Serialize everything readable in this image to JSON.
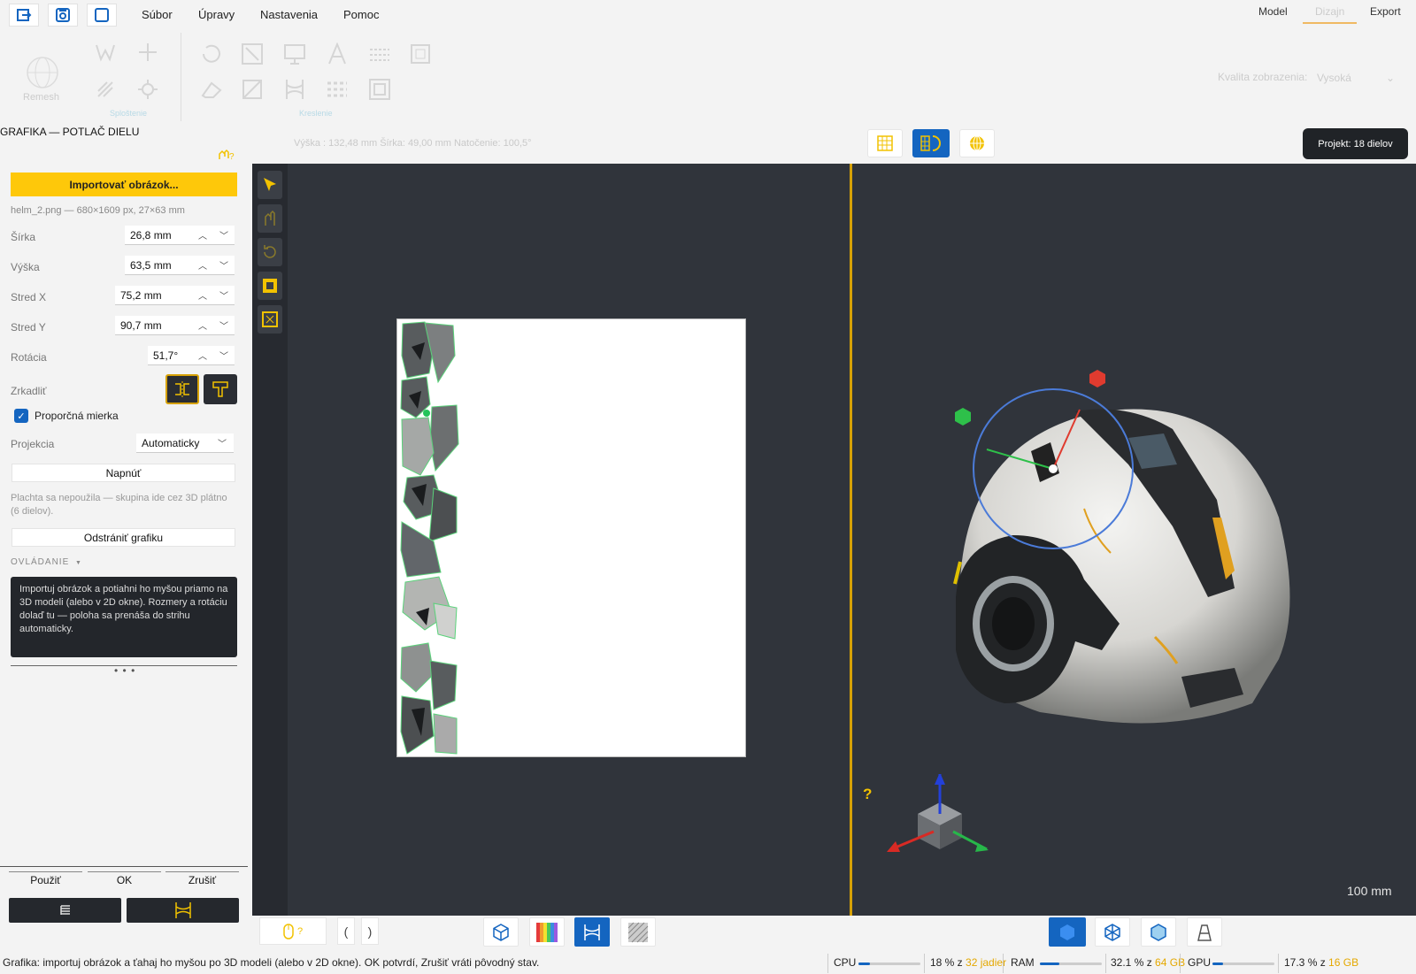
{
  "menubar": {
    "items": [
      "Súbor",
      "Úpravy",
      "Nastavenia",
      "Pomoc"
    ],
    "modes": [
      "Model",
      "Dizajn",
      "Export"
    ],
    "active_mode": "Dizajn"
  },
  "ribbon": {
    "remesh_label": "Remesh",
    "group1_label": "Sploštenie",
    "group2_label": "Kreslenie",
    "quality_label": "Kvalita zobrazenia:",
    "quality_value": "Vysoká"
  },
  "panel": {
    "title": "GRAFIKA — POTLAČ DIELU",
    "import_label": "Importovať obrázok...",
    "file_info": "helm_2.png — 680×1609 px, 27×63 mm",
    "fields": [
      {
        "label": "Šírka",
        "value": "26,8 mm"
      },
      {
        "label": "Výška",
        "value": "63,5 mm"
      },
      {
        "label": "Stred X",
        "value": "75,2 mm"
      },
      {
        "label": "Stred Y",
        "value": "90,7 mm"
      },
      {
        "label": "Rotácia",
        "value": "51,7°"
      }
    ],
    "mirror_label": "Zrkadliť",
    "proportional_label": "Proporčná mierka",
    "proportional_checked": true,
    "projection_label": "Projekcia",
    "projection_value": "Automaticky",
    "stretch_label": "Napnúť",
    "hint": "Plachta sa nepoužila — skupina ide cez 3D plátno (6 dielov).",
    "remove_label": "Odstrániť grafiku",
    "controls_section": "OVLÁDANIE",
    "help_text": "Importuj obrázok a potiahni ho myšou priamo na 3D modeli (alebo v 2D okne). Rozmery a rotáciu dolaď tu — poloha sa prenáša do strihu automaticky.",
    "dots": "• • •",
    "buttons": {
      "apply": "Použiť",
      "ok": "OK",
      "cancel": "Zrušiť"
    }
  },
  "infobar": {
    "text": "Výška : 132,48 mm   Šírka: 49,00 mm   Natočenie: 100,5°"
  },
  "project_badge": "Projekt: 18 dielov",
  "viewport": {
    "scale_label": "100 mm",
    "help_mark": "?"
  },
  "bottom": {
    "mouse_hint": "?",
    "prev": "(",
    "next": ")"
  },
  "status": {
    "message": "Grafika: importuj obrázok a ťahaj ho myšou po 3D modeli (alebo v 2D okne). OK potvrdí, Zrušiť vráti pôvodný stav.",
    "cpu_label": "CPU",
    "cpu_value": "18 % z",
    "cpu_extra": "32 jadier",
    "cpu_fraction": 0.18,
    "ram_label": "RAM",
    "ram_value": "32.1 % z",
    "ram_extra": "64 GB",
    "ram_fraction": 0.321,
    "gpu_label": "GPU",
    "gpu_value": "17.3 % z",
    "gpu_extra": "16 GB",
    "gpu_fraction": 0.173
  },
  "colors": {
    "accent_yellow": "#fec80a",
    "accent_blue": "#1465c0",
    "viewport_bg": "#30343b",
    "divider_gold": "#d6a106"
  }
}
